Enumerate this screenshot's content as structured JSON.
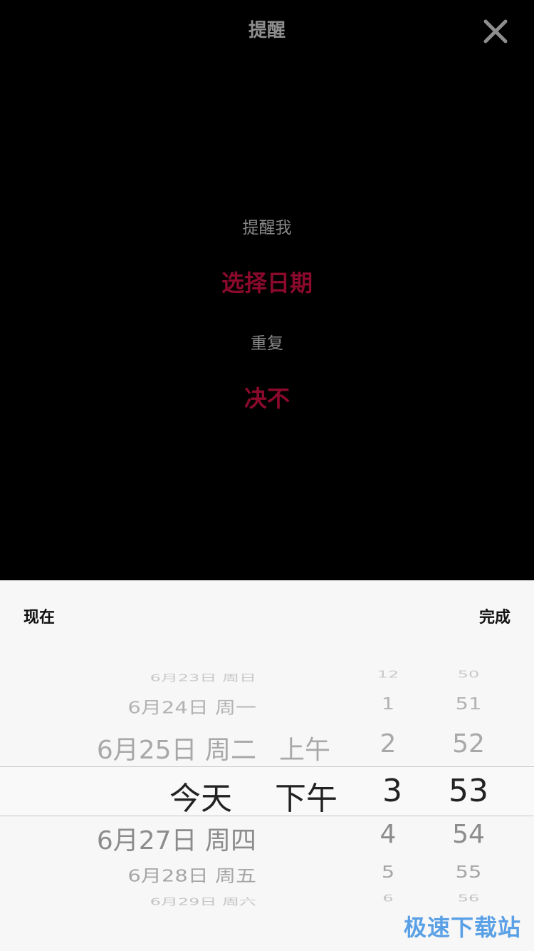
{
  "header": {
    "title": "提醒",
    "close_icon": "close-icon"
  },
  "main": {
    "remind_label": "提醒我",
    "date_value": "选择日期",
    "repeat_label": "重复",
    "repeat_value": "决不"
  },
  "sheet": {
    "now_label": "现在",
    "done_label": "完成",
    "picker": {
      "rows": [
        {
          "date": "6月23日 周日",
          "ampm": "",
          "hour": "12",
          "minute": "50"
        },
        {
          "date": "6月24日 周一",
          "ampm": "",
          "hour": "1",
          "minute": "51"
        },
        {
          "date": "6月25日 周二",
          "ampm": "上午",
          "hour": "2",
          "minute": "52"
        },
        {
          "date": "今天",
          "ampm": "下午",
          "hour": "3",
          "minute": "53"
        },
        {
          "date": "6月27日 周四",
          "ampm": "",
          "hour": "4",
          "minute": "54"
        },
        {
          "date": "6月28日 周五",
          "ampm": "",
          "hour": "5",
          "minute": "55"
        },
        {
          "date": "6月29日 周六",
          "ampm": "",
          "hour": "6",
          "minute": "56"
        }
      ]
    }
  },
  "watermark": "极速下载站",
  "colors": {
    "accent": "#8b0a2c",
    "background": "#000000",
    "sheet": "#f7f7f7"
  }
}
